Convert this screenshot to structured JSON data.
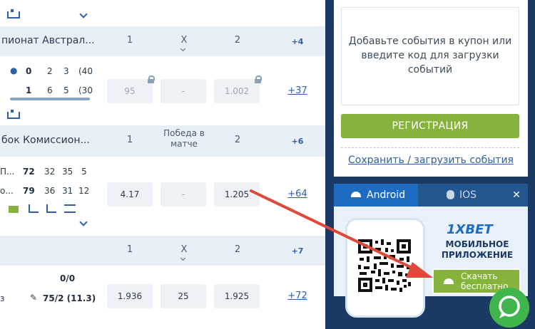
{
  "leagues": [
    {
      "name": "пионат Австрал...",
      "col1": "1",
      "col2": "X",
      "col3": "2",
      "more": "+4"
    },
    {
      "name": "бок Комиссион...",
      "col1": "1",
      "col2": "Победа в матче",
      "col3": "2",
      "more": "+6"
    },
    {
      "name": "",
      "col1": "1",
      "col2": "X",
      "col3": "2",
      "more": "+7"
    }
  ],
  "match1": {
    "score_top": "0",
    "score_bottom": "1",
    "top_sets": [
      "2",
      "3",
      "(40"
    ],
    "bottom_sets": [
      "6",
      "5",
      "(30"
    ],
    "odds": [
      "95",
      "-",
      "1.002"
    ],
    "more": "+37"
  },
  "match2": {
    "p1_abbr": "П...",
    "p2_abbr": "о...",
    "p1_score": "72",
    "p2_score": "79",
    "p1_sets": [
      "32",
      "35",
      "5"
    ],
    "p2_sets": [
      "36",
      "31",
      "12"
    ],
    "odds": [
      "4.17",
      "-",
      "1.205"
    ],
    "more": "+64"
  },
  "match3": {
    "score": "0/0",
    "stat": "75/2 (11.3)",
    "left_abbr": "з",
    "odds": [
      "1.936",
      "25",
      "1.925"
    ],
    "more": "+72"
  },
  "coupon": {
    "message": "Добавьте события в купон или введите код для загрузки событий",
    "register": "РЕГИСТРАЦИЯ",
    "save_link": "Сохранить / загрузить события"
  },
  "app": {
    "tab_android": "Android",
    "tab_ios": "IOS",
    "close": "✕",
    "brand": "1XBET",
    "title": "МОБИЛЬНОЕ ПРИЛОЖЕНИЕ",
    "download": "Скачать бесплатно"
  },
  "colors": {
    "accent": "#2e5fa8",
    "green": "#86b33b",
    "sidebar": "#1b3a63",
    "arrow": "#e0483a"
  }
}
